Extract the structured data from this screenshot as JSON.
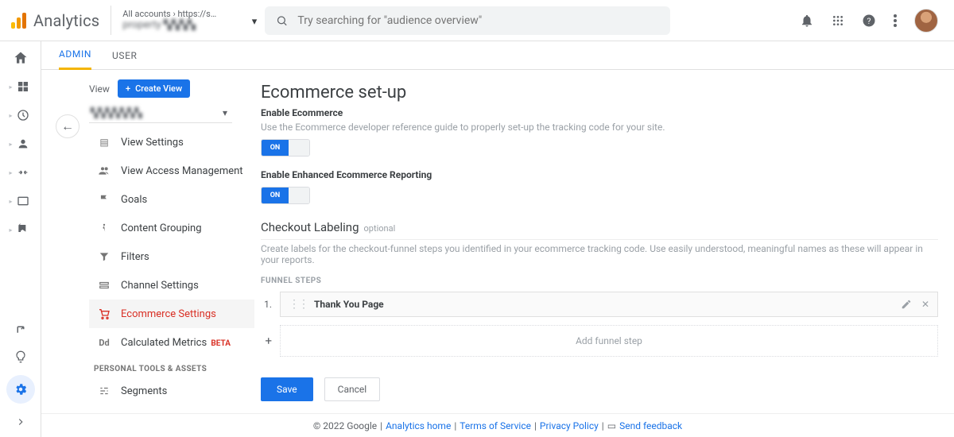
{
  "brand": "Analytics",
  "account": {
    "breadcrumb": "All accounts › https://s…",
    "name": "property ▚▚▚▚"
  },
  "search": {
    "placeholder": "Try searching for \"audience overview\""
  },
  "tabs": {
    "admin": "ADMIN",
    "user": "USER"
  },
  "viewbar": {
    "label": "View",
    "create": "Create View",
    "selected": "▚▚▚▚▚▚▚"
  },
  "nav": {
    "view_settings": "View Settings",
    "access": "View Access Management",
    "goals": "Goals",
    "grouping": "Content Grouping",
    "filters": "Filters",
    "channel": "Channel Settings",
    "ecommerce": "Ecommerce Settings",
    "calc": "Calculated Metrics",
    "beta": "BETA",
    "pt_header": "PERSONAL TOOLS & ASSETS",
    "segments": "Segments"
  },
  "main": {
    "title": "Ecommerce set-up",
    "enable_label": "Enable Ecommerce",
    "enable_help": "Use the Ecommerce developer reference guide to properly set-up the tracking code for your site.",
    "on": "ON",
    "enhanced_label": "Enable Enhanced Ecommerce Reporting",
    "checkout_title": "Checkout Labeling",
    "optional": "optional",
    "checkout_help": "Create labels for the checkout-funnel steps you identified in your ecommerce tracking code. Use easily understood, meaningful names as these will appear in your reports.",
    "funnel_header": "FUNNEL STEPS",
    "step_num": "1.",
    "step_name": "Thank You Page",
    "add_step": "Add funnel step",
    "save": "Save",
    "cancel": "Cancel"
  },
  "footer": {
    "copyright": "© 2022 Google",
    "home": "Analytics home",
    "tos": "Terms of Service",
    "privacy": "Privacy Policy",
    "feedback": "Send feedback"
  }
}
